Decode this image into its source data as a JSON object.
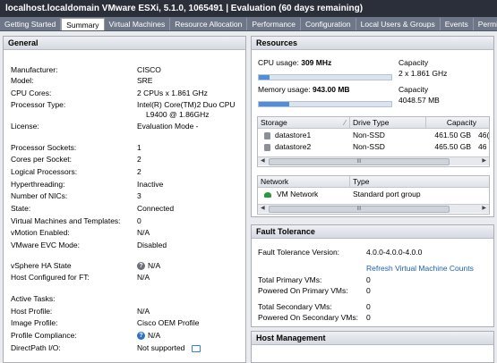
{
  "window_title": "localhost.localdomain VMware ESXi, 5.1.0, 1065491 | Evaluation (60 days remaining)",
  "tabs": [
    "Getting Started",
    "Summary",
    "Virtual Machines",
    "Resource Allocation",
    "Performance",
    "Configuration",
    "Local Users & Groups",
    "Events",
    "Permi"
  ],
  "active_tab": "Summary",
  "general": {
    "title": "General",
    "rows": [
      {
        "label": "Manufacturer:",
        "value": "CISCO"
      },
      {
        "label": "Model:",
        "value": "SRE"
      },
      {
        "label": "CPU Cores:",
        "value": "2 CPUs x 1.861 GHz"
      },
      {
        "label": "Processor Type:",
        "value": "Intel(R) Core(TM)2 Duo CPU",
        "value2": "L9400  @ 1.86GHz"
      },
      {
        "label": "License:",
        "value": "Evaluation Mode -"
      },
      {
        "label": "Processor Sockets:",
        "value": "1"
      },
      {
        "label": "Cores per Socket:",
        "value": "2"
      },
      {
        "label": "Logical Processors:",
        "value": "2"
      },
      {
        "label": "Hyperthreading:",
        "value": "Inactive"
      },
      {
        "label": "Number of NICs:",
        "value": "3"
      },
      {
        "label": "State:",
        "value": "Connected"
      },
      {
        "label": "Virtual Machines and Templates:",
        "value": "0"
      },
      {
        "label": "vMotion Enabled:",
        "value": "N/A"
      },
      {
        "label": "VMware EVC Mode:",
        "value": "Disabled"
      },
      {
        "label": "vSphere HA State",
        "value": "N/A"
      },
      {
        "label": "Host Configured for FT:",
        "value": "N/A"
      },
      {
        "label": "Active Tasks:",
        "value": ""
      },
      {
        "label": "Host Profile:",
        "value": "N/A"
      },
      {
        "label": "Image Profile:",
        "value": "Cisco OEM Profile"
      },
      {
        "label": "Profile Compliance:",
        "value": "N/A"
      },
      {
        "label": "DirectPath I/O:",
        "value": "Not supported"
      }
    ]
  },
  "resources": {
    "title": "Resources",
    "cpu_label": "CPU usage:",
    "cpu_value": "309 MHz",
    "cpu_fraction": 0.08,
    "cpu_capacity_label": "Capacity",
    "cpu_capacity": "2 x 1.861 GHz",
    "mem_label": "Memory usage:",
    "mem_value": "943.00 MB",
    "mem_fraction": 0.23,
    "mem_capacity_label": "Capacity",
    "mem_capacity": "4048.57 MB",
    "storage_headers": [
      "Storage",
      "Drive Type",
      "Capacity"
    ],
    "storage_rows": [
      {
        "name": "datastore1",
        "type": "Non-SSD",
        "capacity": "461.50 GB",
        "extra": "46("
      },
      {
        "name": "datastore2",
        "type": "Non-SSD",
        "capacity": "465.50 GB",
        "extra": "46"
      }
    ],
    "network_headers": [
      "Network",
      "Type"
    ],
    "network_rows": [
      {
        "name": "VM Network",
        "type": "Standard port group"
      }
    ],
    "scroll_grip": "III"
  },
  "fault_tolerance": {
    "title": "Fault Tolerance",
    "version_label": "Fault Tolerance Version:",
    "version_value": "4.0.0-4.0.0-4.0.0",
    "refresh_link": "Refresh Virtual Machine Counts",
    "rows": [
      {
        "label": "Total Primary VMs:",
        "value": "0"
      },
      {
        "label": "Powered On Primary VMs:",
        "value": "0"
      },
      {
        "label": "Total Secondary VMs:",
        "value": "0"
      },
      {
        "label": "Powered On Secondary VMs:",
        "value": "0"
      }
    ]
  },
  "host_management": {
    "title": "Host Management"
  },
  "icons": [
    "help-icon",
    "compliance-icon",
    "chat-icon",
    "datastore-icon",
    "network-icon",
    "sort-arrow-icon"
  ]
}
